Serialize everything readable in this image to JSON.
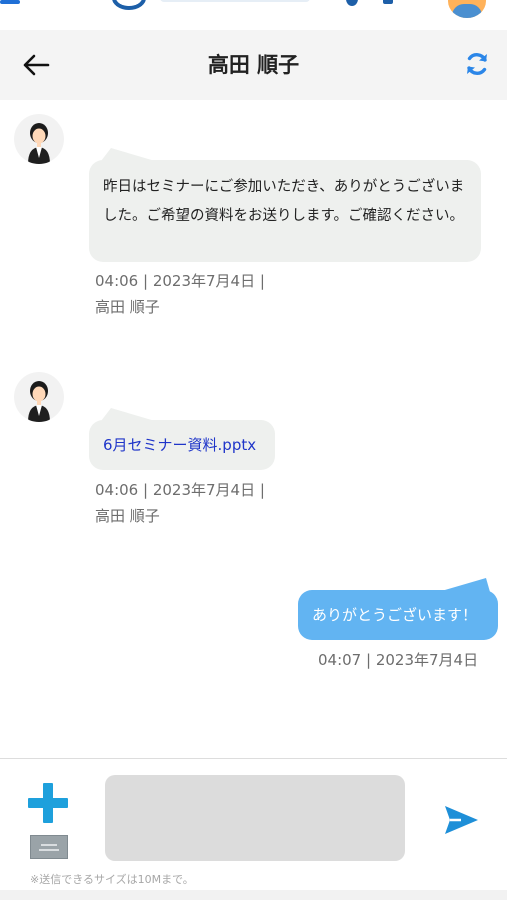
{
  "header": {
    "title": "高田 順子",
    "back_icon": "arrow-left-icon",
    "refresh_icon": "refresh-icon"
  },
  "messages": [
    {
      "sender": "高田 順子",
      "text": "昨日はセミナーにご参加いただき、ありがとうございました。ご希望の資料をお送りします。ご確認ください。",
      "meta_time": "04:06 | 2023年7月4日 |",
      "meta_name": "高田 順子"
    },
    {
      "sender": "高田 順子",
      "file": "6月セミナー資料.pptx",
      "meta_time": "04:06 | 2023年7月4日 |",
      "meta_name": "高田 順子"
    },
    {
      "sender": "me",
      "text": "ありがとうございます！",
      "meta_time": "04:07 | 2023年7月4日"
    }
  ],
  "composer": {
    "input_value": "",
    "note": "※送信できるサイズは10Mまで。",
    "add_icon": "plus-icon",
    "send_icon": "send-icon"
  },
  "colors": {
    "header_bg": "#f4f4f4",
    "incoming_bubble": "#eef0ee",
    "outgoing_bubble": "#62b4f2",
    "accent": "#1ea0dc",
    "link": "#1f35c9"
  }
}
